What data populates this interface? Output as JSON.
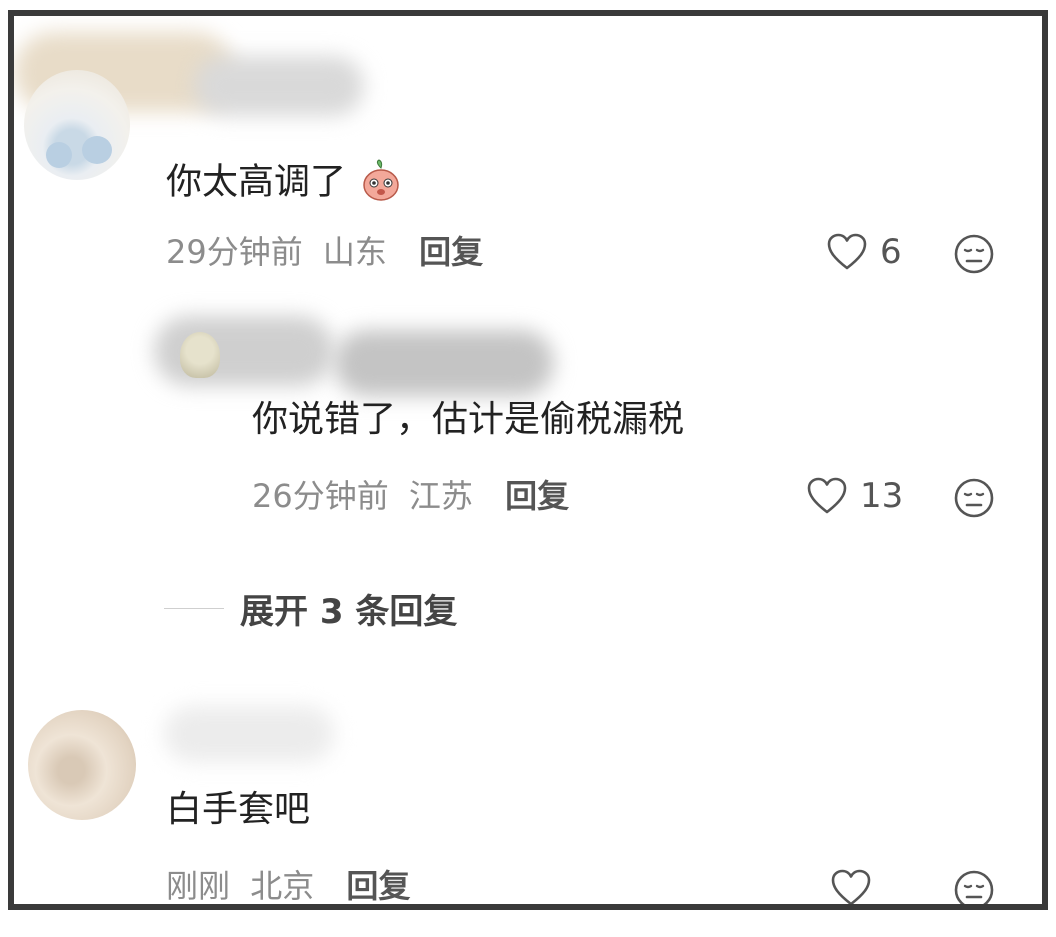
{
  "comments": [
    {
      "text": "你太高调了",
      "emoji": "blush-peach-emoji",
      "time": "29分钟前",
      "location": "山东",
      "reply_label": "回复",
      "likes": "6"
    },
    {
      "text": "你说错了，估计是偷税漏税",
      "time": "26分钟前",
      "location": "江苏",
      "reply_label": "回复",
      "likes": "13"
    },
    {
      "text": "白手套吧",
      "time": "刚刚",
      "location": "北京",
      "reply_label": "回复",
      "likes": ""
    }
  ],
  "expand_replies": {
    "label": "展开 3 条回复"
  },
  "icons": {
    "like": "heart-outline-icon",
    "dislike": "meh-face-icon"
  },
  "colors": {
    "frame_border": "#3a3a3a",
    "text": "#222222",
    "meta": "#8c8c8c",
    "reply": "#555555"
  }
}
